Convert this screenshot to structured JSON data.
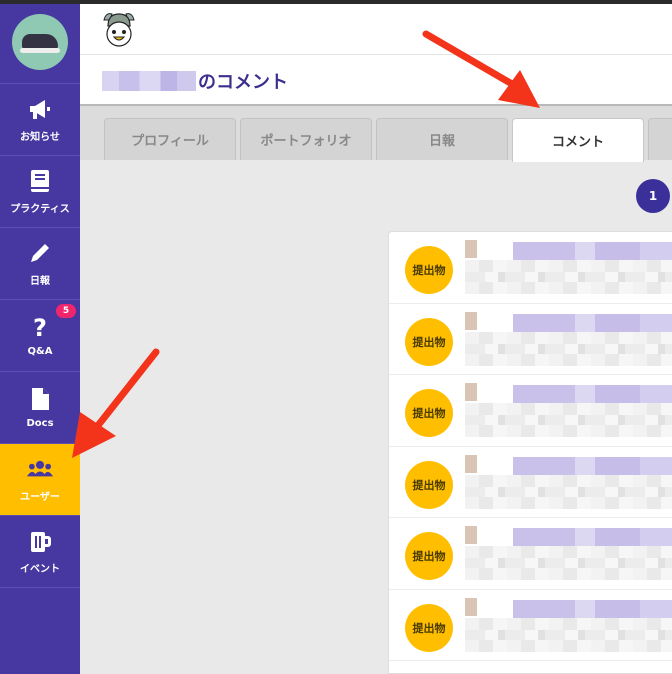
{
  "header": {
    "title_suffix": "のコメント"
  },
  "sidebar": {
    "items": [
      {
        "label": "お知らせ",
        "icon": "megaphone-icon"
      },
      {
        "label": "プラクティス",
        "icon": "book-icon"
      },
      {
        "label": "日報",
        "icon": "pencil-icon"
      },
      {
        "label": "Q&A",
        "icon": "question-icon",
        "badge": "5"
      },
      {
        "label": "Docs",
        "icon": "document-icon"
      },
      {
        "label": "ユーザー",
        "icon": "users-icon",
        "active": true
      },
      {
        "label": "イベント",
        "icon": "mug-icon"
      }
    ]
  },
  "tabs": [
    {
      "label": "プロフィール"
    },
    {
      "label": "ポートフォリオ"
    },
    {
      "label": "日報"
    },
    {
      "label": "コメント",
      "active": true
    }
  ],
  "pagination": {
    "current": "1"
  },
  "comments": [
    {
      "type_label": "提出物"
    },
    {
      "type_label": "提出物"
    },
    {
      "type_label": "提出物"
    },
    {
      "type_label": "提出物"
    },
    {
      "type_label": "提出物"
    },
    {
      "type_label": "提出物"
    }
  ],
  "colors": {
    "sidebar": "#4638a0",
    "accent": "#ffbf00",
    "title": "#3b2f8f",
    "badge": "#f0266d",
    "annotation_arrow": "#f3331a"
  }
}
